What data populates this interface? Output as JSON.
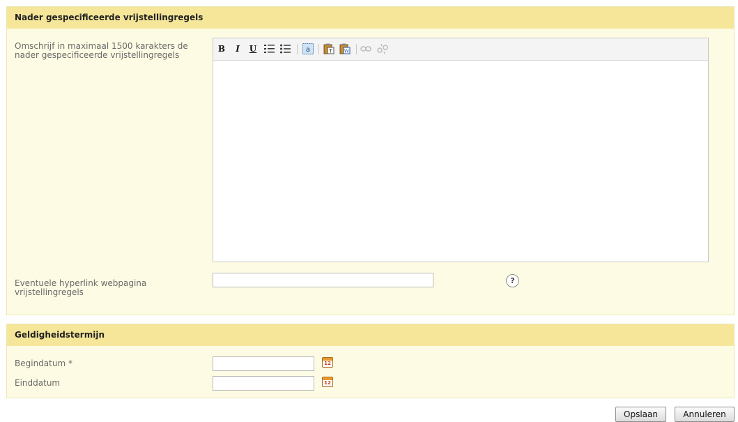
{
  "sections": {
    "exemption": {
      "title": "Nader gespecificeerde vrijstellingregels",
      "description_label_line1": "Omschrijf in maximaal 1500 karakters de",
      "description_label_line2": "nader gespecificeerde vrijstellingregels",
      "description_value": "",
      "toolbar": {
        "bold": "B",
        "italic": "I",
        "underline": "U",
        "icons": [
          "bold-icon",
          "italic-icon",
          "underline-icon",
          "ordered-list-icon",
          "unordered-list-icon",
          "select-all-icon",
          "paste-text-icon",
          "paste-word-icon",
          "link-icon",
          "unlink-icon"
        ]
      },
      "hyperlink_label_line1": "Eventuele hyperlink webpagina",
      "hyperlink_label_line2": "vrijstellingregels",
      "hyperlink_value": "",
      "help_symbol": "?"
    },
    "validity": {
      "title": "Geldigheidstermijn",
      "start_label": "Begindatum *",
      "start_value": "",
      "end_label": "Einddatum",
      "end_value": "",
      "calendar_day": "12"
    }
  },
  "actions": {
    "save_label": "Opslaan",
    "cancel_label": "Annuleren"
  },
  "colors": {
    "panel_bg": "#fdfbe3",
    "header_bg": "#f5e699"
  }
}
